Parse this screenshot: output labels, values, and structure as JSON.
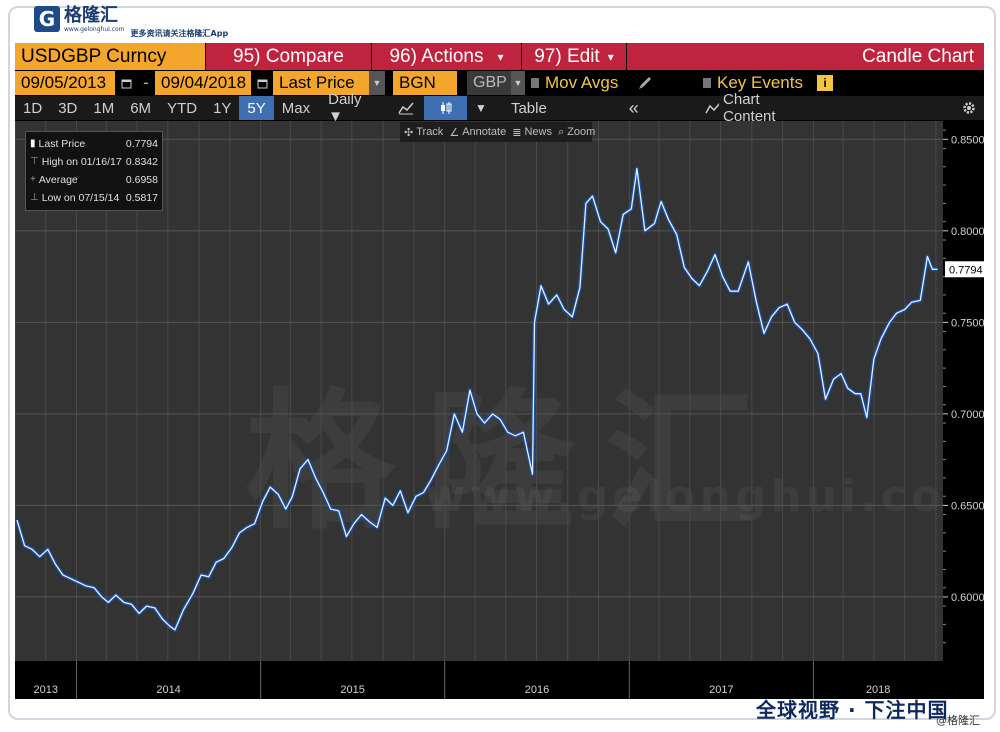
{
  "brand": {
    "logo_letter": "G",
    "name": "格隆汇",
    "url": "www.gelonghui.com",
    "tagline": "更多资讯请关注格隆汇App"
  },
  "header": {
    "security": "USDGBP Curncy",
    "compare": "95) Compare",
    "actions": "96) Actions",
    "actions_arrow": "▾",
    "edit": "97) Edit",
    "edit_arrow": "▾",
    "chart_type": "Candle Chart"
  },
  "controls": {
    "start_date": "09/05/2013",
    "dash": "-",
    "end_date": "09/04/2018",
    "price_field": "Last Price",
    "source": "BGN",
    "currency": "GBP",
    "mov_avgs": "Mov Avgs",
    "key_events": "Key Events",
    "info_icon_label": "i"
  },
  "periods": [
    "1D",
    "3D",
    "1M",
    "6M",
    "YTD",
    "1Y",
    "5Y",
    "Max"
  ],
  "active_period": "5Y",
  "frequency": "Daily ▼",
  "table_label": "Table",
  "collapse_label": "«",
  "chart_content_label": "Chart Content",
  "chart_toolbar": {
    "track": "Track",
    "annotate": "Annotate",
    "news": "News",
    "zoom": "Zoom"
  },
  "legend": [
    {
      "label": "Last Price",
      "value": "0.7794"
    },
    {
      "label": "High on 01/16/17",
      "value": "0.8342"
    },
    {
      "label": "Average",
      "value": "0.6958"
    },
    {
      "label": "Low on 07/15/14",
      "value": "0.5817"
    }
  ],
  "watermark": {
    "text": "格隆汇",
    "url": "www.gelonghui.com"
  },
  "chart_data": {
    "type": "line",
    "title": "",
    "xlabel": "",
    "ylabel": "",
    "ylim": [
      0.565,
      0.86
    ],
    "yticks": [
      "0.6000",
      "0.6500",
      "0.7000",
      "0.7500",
      "0.8000",
      "0.8500"
    ],
    "ytick_values": [
      0.6,
      0.65,
      0.7,
      0.75,
      0.8,
      0.85
    ],
    "x_labels": [
      "2013",
      "2014",
      "2015",
      "2016",
      "2017",
      "2018"
    ],
    "last_price_tag": "0.7794",
    "grid": true,
    "series": [
      {
        "values": [
          [
            "2013-09-05",
            0.642
          ],
          [
            "2013-09-20",
            0.628
          ],
          [
            "2013-10-05",
            0.626
          ],
          [
            "2013-10-20",
            0.622
          ],
          [
            "2013-11-05",
            0.626
          ],
          [
            "2013-11-20",
            0.618
          ],
          [
            "2013-12-05",
            0.612
          ],
          [
            "2013-12-20",
            0.61
          ],
          [
            "2014-01-05",
            0.608
          ],
          [
            "2014-01-20",
            0.606
          ],
          [
            "2014-02-05",
            0.605
          ],
          [
            "2014-02-20",
            0.6
          ],
          [
            "2014-03-05",
            0.597
          ],
          [
            "2014-03-20",
            0.601
          ],
          [
            "2014-04-05",
            0.597
          ],
          [
            "2014-04-20",
            0.596
          ],
          [
            "2014-05-05",
            0.591
          ],
          [
            "2014-05-20",
            0.595
          ],
          [
            "2014-06-05",
            0.594
          ],
          [
            "2014-06-20",
            0.588
          ],
          [
            "2014-07-05",
            0.584
          ],
          [
            "2014-07-15",
            0.582
          ],
          [
            "2014-08-01",
            0.593
          ],
          [
            "2014-08-20",
            0.602
          ],
          [
            "2014-09-05",
            0.612
          ],
          [
            "2014-09-20",
            0.611
          ],
          [
            "2014-10-05",
            0.619
          ],
          [
            "2014-10-20",
            0.621
          ],
          [
            "2014-11-05",
            0.627
          ],
          [
            "2014-11-20",
            0.635
          ],
          [
            "2014-12-05",
            0.638
          ],
          [
            "2014-12-20",
            0.64
          ],
          [
            "2015-01-05",
            0.652
          ],
          [
            "2015-01-20",
            0.66
          ],
          [
            "2015-02-05",
            0.656
          ],
          [
            "2015-02-20",
            0.648
          ],
          [
            "2015-03-05",
            0.655
          ],
          [
            "2015-03-20",
            0.67
          ],
          [
            "2015-04-05",
            0.675
          ],
          [
            "2015-04-20",
            0.665
          ],
          [
            "2015-05-05",
            0.657
          ],
          [
            "2015-05-20",
            0.648
          ],
          [
            "2015-06-05",
            0.647
          ],
          [
            "2015-06-20",
            0.633
          ],
          [
            "2015-07-05",
            0.64
          ],
          [
            "2015-07-20",
            0.645
          ],
          [
            "2015-08-05",
            0.641
          ],
          [
            "2015-08-20",
            0.638
          ],
          [
            "2015-09-05",
            0.654
          ],
          [
            "2015-09-20",
            0.65
          ],
          [
            "2015-10-05",
            0.658
          ],
          [
            "2015-10-20",
            0.646
          ],
          [
            "2015-11-05",
            0.655
          ],
          [
            "2015-11-20",
            0.657
          ],
          [
            "2015-12-05",
            0.664
          ],
          [
            "2015-12-20",
            0.672
          ],
          [
            "2016-01-05",
            0.68
          ],
          [
            "2016-01-20",
            0.7
          ],
          [
            "2016-02-05",
            0.69
          ],
          [
            "2016-02-20",
            0.713
          ],
          [
            "2016-03-05",
            0.7
          ],
          [
            "2016-03-20",
            0.695
          ],
          [
            "2016-04-05",
            0.7
          ],
          [
            "2016-04-20",
            0.697
          ],
          [
            "2016-05-05",
            0.69
          ],
          [
            "2016-05-20",
            0.688
          ],
          [
            "2016-06-05",
            0.69
          ],
          [
            "2016-06-23",
            0.667
          ],
          [
            "2016-06-27",
            0.75
          ],
          [
            "2016-07-10",
            0.77
          ],
          [
            "2016-07-25",
            0.76
          ],
          [
            "2016-08-10",
            0.765
          ],
          [
            "2016-08-25",
            0.757
          ],
          [
            "2016-09-10",
            0.753
          ],
          [
            "2016-09-25",
            0.769
          ],
          [
            "2016-10-07",
            0.815
          ],
          [
            "2016-10-20",
            0.819
          ],
          [
            "2016-11-05",
            0.805
          ],
          [
            "2016-11-20",
            0.801
          ],
          [
            "2016-12-05",
            0.788
          ],
          [
            "2016-12-20",
            0.809
          ],
          [
            "2017-01-05",
            0.812
          ],
          [
            "2017-01-16",
            0.834
          ],
          [
            "2017-02-01",
            0.8
          ],
          [
            "2017-02-20",
            0.804
          ],
          [
            "2017-03-05",
            0.816
          ],
          [
            "2017-03-20",
            0.806
          ],
          [
            "2017-04-05",
            0.798
          ],
          [
            "2017-04-20",
            0.78
          ],
          [
            "2017-05-05",
            0.774
          ],
          [
            "2017-05-20",
            0.77
          ],
          [
            "2017-06-05",
            0.778
          ],
          [
            "2017-06-20",
            0.787
          ],
          [
            "2017-07-05",
            0.775
          ],
          [
            "2017-07-20",
            0.767
          ],
          [
            "2017-08-05",
            0.767
          ],
          [
            "2017-08-25",
            0.783
          ],
          [
            "2017-09-10",
            0.761
          ],
          [
            "2017-09-25",
            0.744
          ],
          [
            "2017-10-10",
            0.753
          ],
          [
            "2017-10-25",
            0.758
          ],
          [
            "2017-11-10",
            0.76
          ],
          [
            "2017-11-25",
            0.75
          ],
          [
            "2017-12-10",
            0.746
          ],
          [
            "2017-12-25",
            0.741
          ],
          [
            "2018-01-10",
            0.733
          ],
          [
            "2018-01-25",
            0.708
          ],
          [
            "2018-02-10",
            0.719
          ],
          [
            "2018-02-25",
            0.722
          ],
          [
            "2018-03-10",
            0.714
          ],
          [
            "2018-03-25",
            0.711
          ],
          [
            "2018-04-05",
            0.711
          ],
          [
            "2018-04-17",
            0.698
          ],
          [
            "2018-05-01",
            0.73
          ],
          [
            "2018-05-15",
            0.741
          ],
          [
            "2018-06-01",
            0.75
          ],
          [
            "2018-06-15",
            0.755
          ],
          [
            "2018-07-01",
            0.757
          ],
          [
            "2018-07-15",
            0.761
          ],
          [
            "2018-08-01",
            0.762
          ],
          [
            "2018-08-15",
            0.786
          ],
          [
            "2018-08-25",
            0.779
          ],
          [
            "2018-09-04",
            0.779
          ]
        ]
      }
    ]
  },
  "footer": {
    "slogan": "全球视野 · 下注中国",
    "handle": "@格隆汇"
  }
}
